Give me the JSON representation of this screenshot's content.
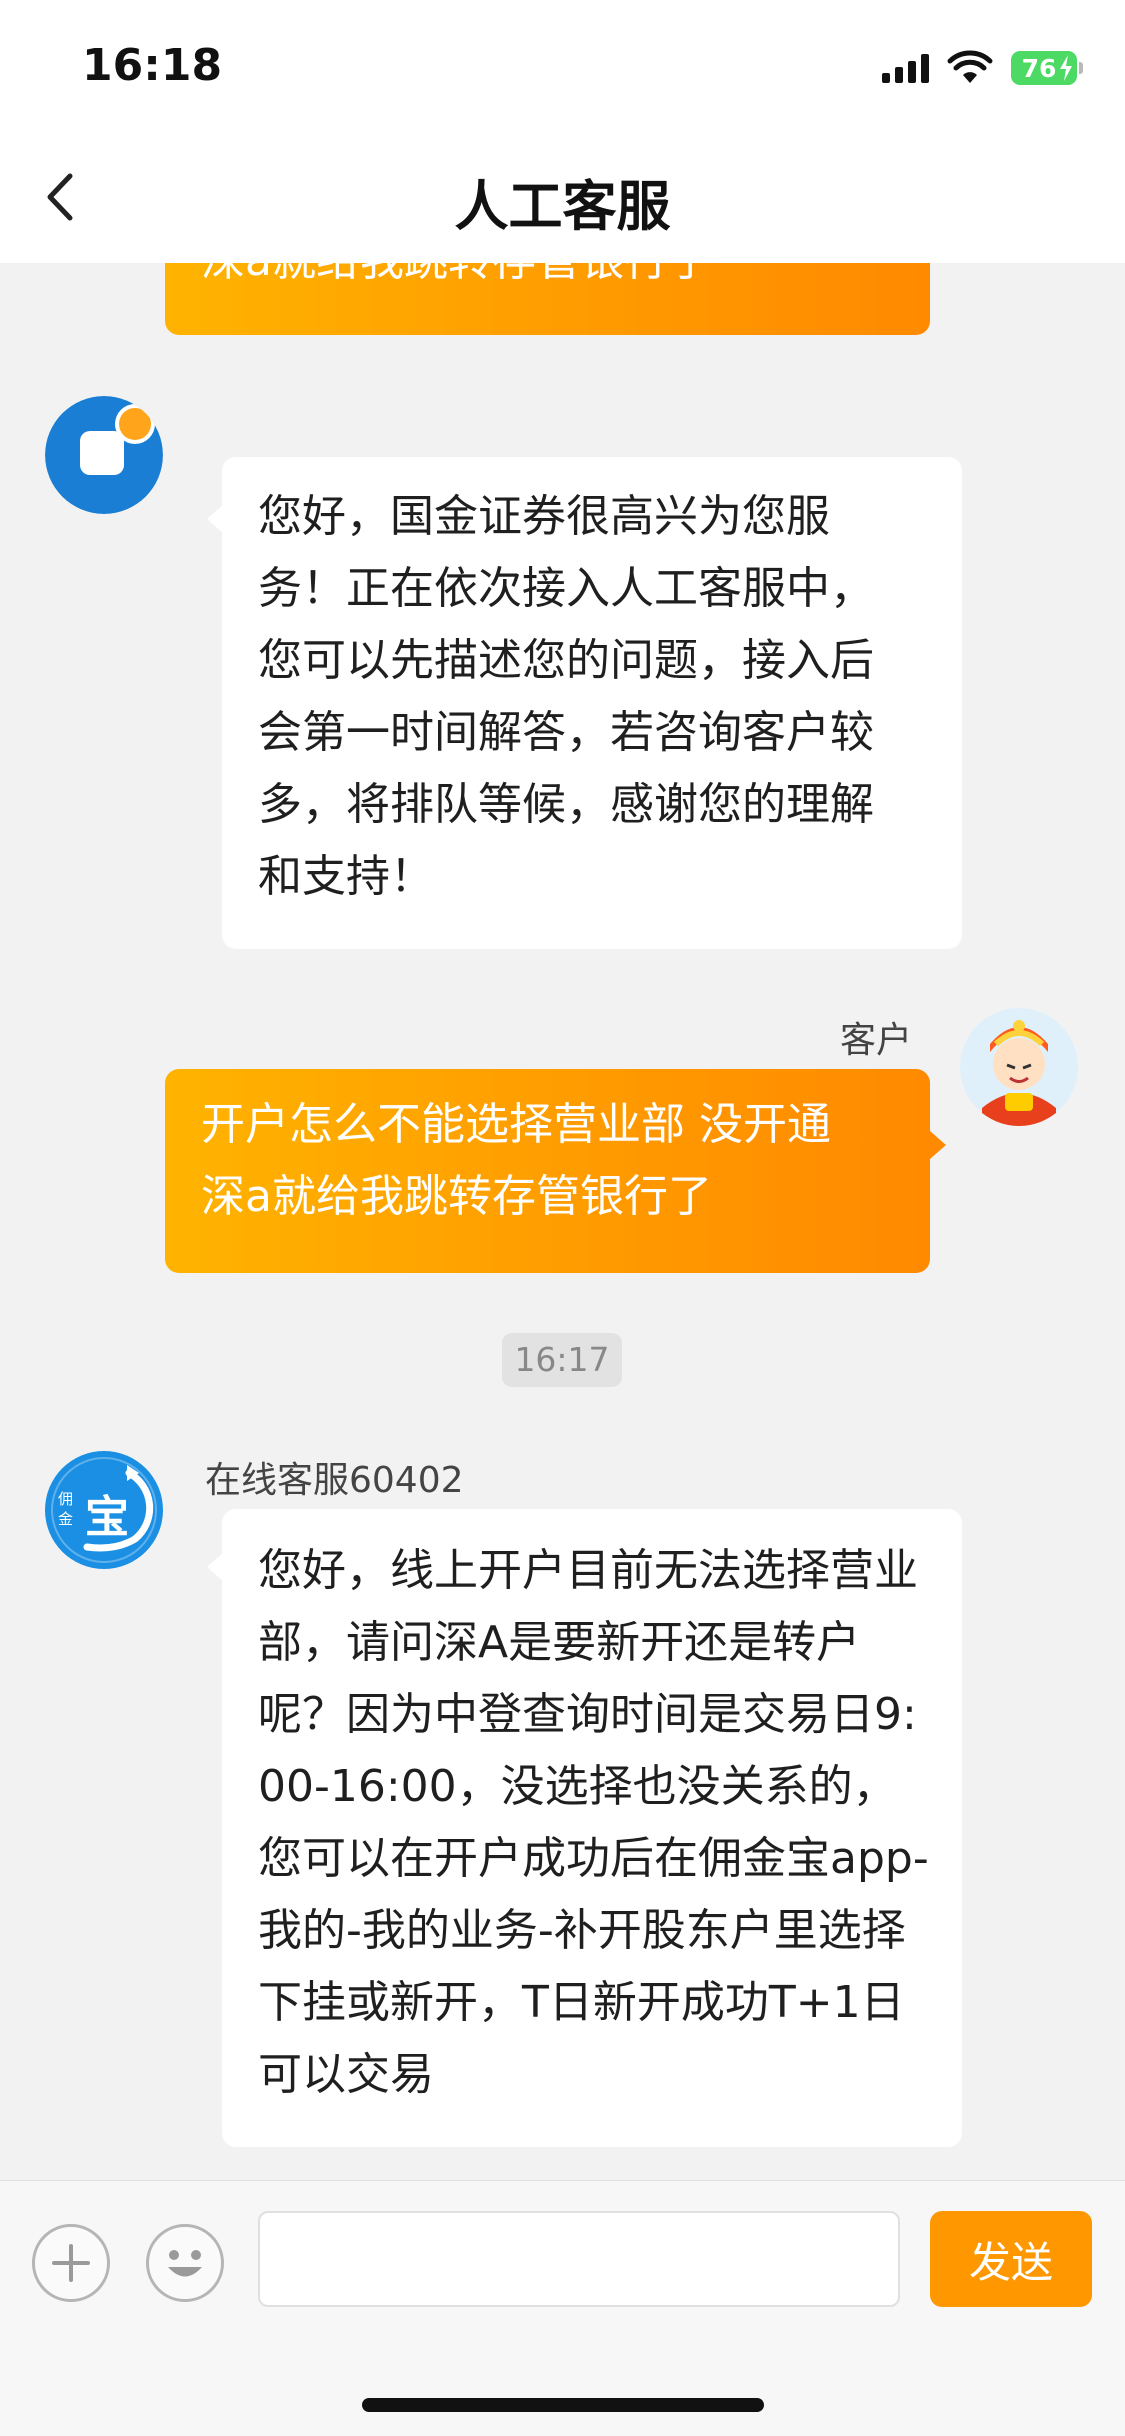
{
  "status_bar": {
    "time": "16:18",
    "battery": "76"
  },
  "header": {
    "title": "人工客服"
  },
  "messages": [
    {
      "sender": "customer",
      "text": "深a就给我跳转存管银行了"
    },
    {
      "sender": "agent",
      "text": "您好，国金证券很高兴为您服务！正在依次接入人工客服中，您可以先描述您的问题，接入后会第一时间解答，若咨询客户较多，将排队等候，感谢您的理解和支持！"
    },
    {
      "sender": "customer",
      "name": "客户",
      "line1": "开户怎么不能选择营业部 没开通",
      "line2": "深a就给我跳转存管银行了"
    },
    {
      "sender": "agent",
      "name": "在线客服60402",
      "text": "您好，线上开户目前无法选择营业部，请问深A是要新开还是转户呢？因为中登查询时间是交易日9:00-16:00，没选择也没关系的，您可以在开户成功后在佣金宝app-我的-我的业务-补开股东户里选择下挂或新开，T日新开成功T+1日可以交易"
    }
  ],
  "timestamp": "16:17",
  "avatars": {
    "agent_logo_text": "宝",
    "agent_logo_small": "佣金"
  },
  "input": {
    "placeholder": "",
    "value": ""
  },
  "send_label": "发送",
  "colors": {
    "accent": "#ff9800",
    "bubble_start": "#ffb300",
    "bubble_end": "#ff8a00"
  }
}
